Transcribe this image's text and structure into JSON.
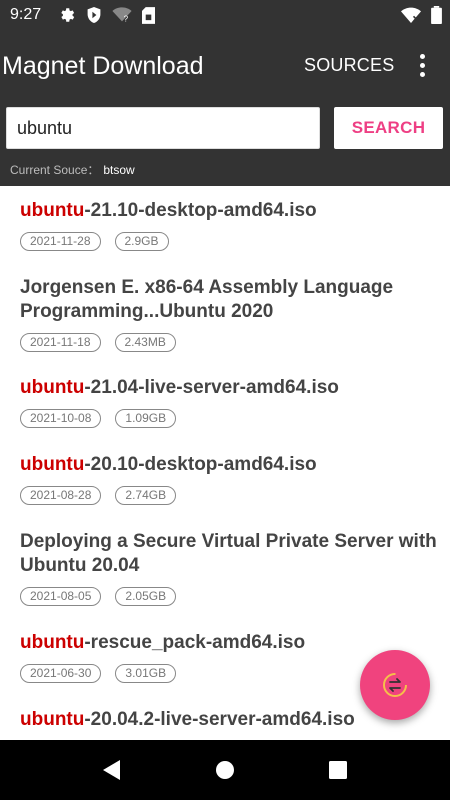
{
  "status_bar": {
    "time": "9:27",
    "icons_left": [
      "gear-icon",
      "shield-icon",
      "wifi-question-icon",
      "sim-card-icon"
    ],
    "icons_right": [
      "wifi-off-icon",
      "battery-icon"
    ]
  },
  "app_bar": {
    "title": "Magnet Download",
    "sources_label": "SOURCES",
    "overflow_icon": "more-vert-icon"
  },
  "search": {
    "value": "ubuntu",
    "button_label": "SEARCH",
    "source_label": "Current Souce：",
    "source_value": "btsow"
  },
  "results": [
    {
      "highlight": "ubuntu",
      "rest": "-21.10-desktop-amd64.iso",
      "date": "2021-11-28",
      "size": "2.9GB"
    },
    {
      "highlight": "",
      "rest": "Jorgensen E. x86-64 Assembly Language Programming...Ubuntu 2020",
      "date": "2021-11-18",
      "size": "2.43MB"
    },
    {
      "highlight": "ubuntu",
      "rest": "-21.04-live-server-amd64.iso",
      "date": "2021-10-08",
      "size": "1.09GB"
    },
    {
      "highlight": "ubuntu",
      "rest": "-20.10-desktop-amd64.iso",
      "date": "2021-08-28",
      "size": "2.74GB"
    },
    {
      "highlight": "",
      "rest": "Deploying a Secure Virtual Private Server with Ubuntu 20.04",
      "date": "2021-08-05",
      "size": "2.05GB"
    },
    {
      "highlight": "ubuntu",
      "rest": "-rescue_pack-amd64.iso",
      "date": "2021-06-30",
      "size": "3.01GB"
    },
    {
      "highlight": "ubuntu",
      "rest": "-20.04.2-live-server-amd64.iso",
      "date": "",
      "size": ""
    }
  ],
  "fab": {
    "icon": "swap-icon"
  },
  "nav_bar": {
    "icons": [
      "back-icon",
      "home-icon",
      "recents-icon"
    ]
  },
  "colors": {
    "accent": "#ee3f84",
    "highlight": "#cc0000",
    "app_bar": "#333333",
    "fab": "#f0437e"
  }
}
